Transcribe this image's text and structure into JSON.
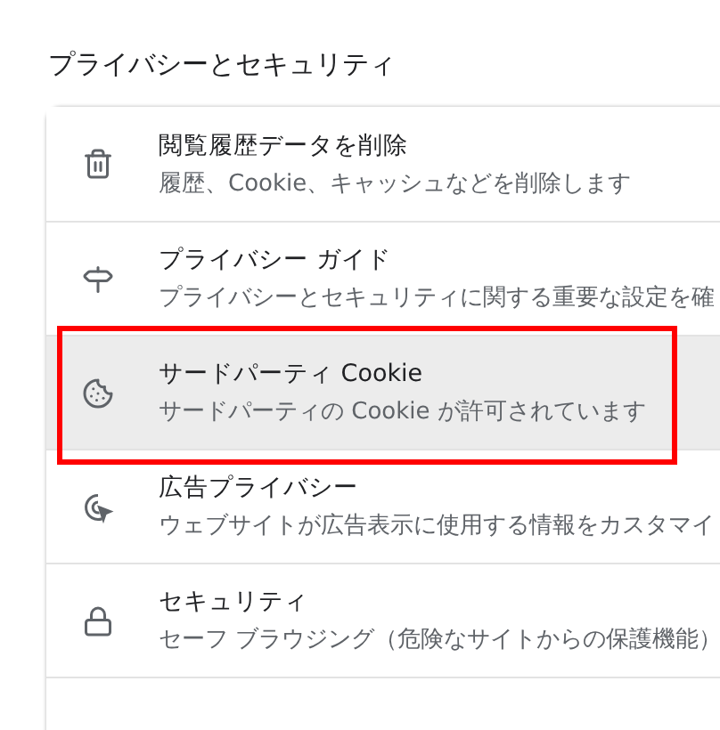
{
  "section_title": "プライバシーとセキュリティ",
  "rows": [
    {
      "title": "閲覧履歴データを削除",
      "subtitle": "履歴、Cookie、キャッシュなどを削除します",
      "highlighted": false
    },
    {
      "title": "プライバシー ガイド",
      "subtitle": "プライバシーとセキュリティに関する重要な設定を確",
      "highlighted": false
    },
    {
      "title": "サードパーティ Cookie",
      "subtitle": "サードパーティの Cookie が許可されています",
      "highlighted": true
    },
    {
      "title": "広告プライバシー",
      "subtitle": "ウェブサイトが広告表示に使用する情報をカスタマイ",
      "highlighted": false
    },
    {
      "title": "セキュリティ",
      "subtitle": "セーフ ブラウジング（危険なサイトからの保護機能）",
      "highlighted": false
    }
  ]
}
